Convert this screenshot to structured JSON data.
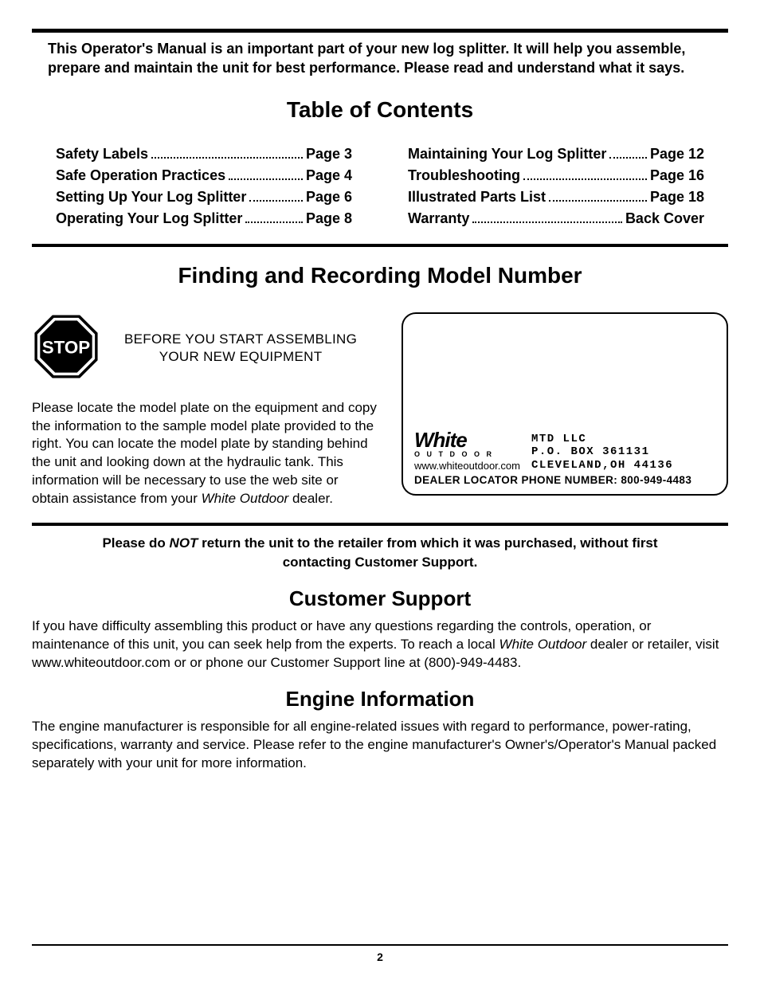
{
  "intro": "This Operator's Manual is an important part of your new log splitter. It will help you assemble, prepare and maintain the unit for best performance. Please read and understand what it says.",
  "toc": {
    "title": "Table of Contents",
    "left": [
      {
        "label": "Safety Labels",
        "page": "Page 3"
      },
      {
        "label": "Safe Operation Practices",
        "page": "Page 4"
      },
      {
        "label": "Setting Up Your Log Splitter",
        "page": "Page 6"
      },
      {
        "label": "Operating Your Log Splitter",
        "page": "Page 8"
      }
    ],
    "right": [
      {
        "label": "Maintaining Your Log Splitter",
        "page": "Page 12"
      },
      {
        "label": "Troubleshooting",
        "page": "Page 16"
      },
      {
        "label": "Illustrated Parts List",
        "page": "Page 18"
      },
      {
        "label": "Warranty",
        "page": "Back Cover"
      }
    ]
  },
  "model": {
    "title": "Finding and Recording Model Number",
    "stop_word": "STOP",
    "caption_l1": "BEFORE YOU START ASSEMBLING",
    "caption_l2": "YOUR NEW EQUIPMENT",
    "body_pre": "Please locate the model plate on the equipment and copy the information to the sample model plate provided to the right. You can locate the model plate by standing behind the unit and looking down at the hydraulic tank. This information will be necessary to use the web site or obtain assistance from your ",
    "body_brand": "White Outdoor",
    "body_post": " dealer."
  },
  "plate": {
    "logo_main": "White",
    "logo_sub": "O U T D O O R",
    "url": "www.whiteoutdoor.com",
    "addr_l1": "MTD LLC",
    "addr_l2": "P.O. BOX 361131",
    "addr_l3": "CLEVELAND,OH 44136",
    "dealer": "DEALER LOCATOR PHONE NUMBER: 800-949-4483"
  },
  "notice": {
    "pre": "Please do ",
    "not": "NOT",
    "post": " return the unit to the retailer from which it was purchased, without first contacting Customer Support."
  },
  "support": {
    "title": "Customer Support",
    "body_pre": "If you have difficulty assembling this product or have any questions regarding the controls, operation, or maintenance of this unit, you can seek help from the experts. To reach a local ",
    "body_brand": "White Outdoor",
    "body_post": " dealer or retailer, visit www.whiteoutdoor.com or or phone our Customer Support line at (800)-949-4483."
  },
  "engine": {
    "title": "Engine Information",
    "body": "The engine manufacturer is responsible for all engine-related issues with regard to performance, power-rating, specifications, warranty and service. Please refer to the engine manufacturer's Owner's/Operator's Manual packed separately with your unit for more information."
  },
  "page_number": "2"
}
